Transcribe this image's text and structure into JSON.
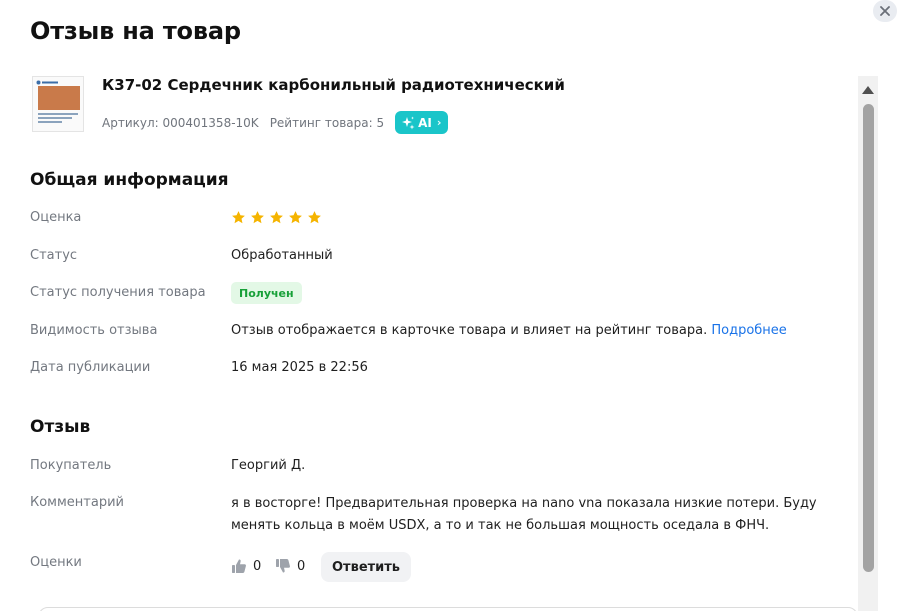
{
  "modal": {
    "title": "Отзыв на товар"
  },
  "product": {
    "name": "К37-02 Сердечник карбонильный радиотехнический",
    "article": "Артикул: 000401358-10K",
    "rating": "Рейтинг товара: 5",
    "ai_label": "AI"
  },
  "general": {
    "title": "Общая информация",
    "rating_label": "Оценка",
    "rating_value": 5,
    "rating_max": 5,
    "status_label": "Статус",
    "status_value": "Обработанный",
    "receipt_label": "Статус получения товара",
    "receipt_value": "Получен",
    "visibility_label": "Видимость отзыва",
    "visibility_value": "Отзыв отображается в карточке товара и влияет на рейтинг товара.",
    "visibility_link": "Подробнее",
    "date_label": "Дата публикации",
    "date_value": "16 мая 2025 в 22:56"
  },
  "review": {
    "title": "Отзыв",
    "buyer_label": "Покупатель",
    "buyer_value": "Георгий Д.",
    "comment_label": "Комментарий",
    "comment_value": "я в восторге! Предварительная проверка на nano vna показала низкие потери. Буду менять кольца в моём USDX, а то и так не большая мощность оседала в ФНЧ.",
    "votes_label": "Оценки",
    "likes": "0",
    "dislikes": "0",
    "reply_label": "Ответить"
  },
  "colors": {
    "star": "#f5b400",
    "accent_teal": "#1ac5c9",
    "link": "#1a73e8",
    "status_green": "#17a038"
  },
  "icons": {
    "close": "close-icon",
    "ai": "sparkle-icon",
    "star": "star-icon",
    "like": "thumb-up-icon",
    "dislike": "thumb-down-icon"
  }
}
